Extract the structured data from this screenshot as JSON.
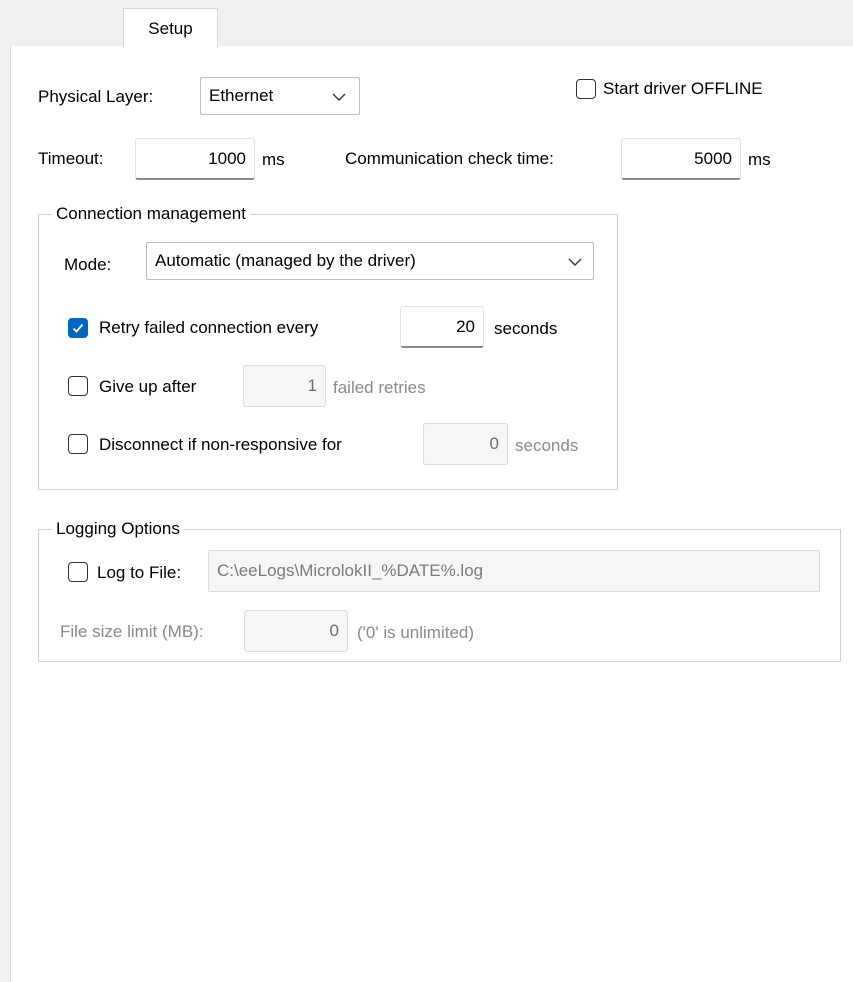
{
  "tab": {
    "label": "Setup"
  },
  "physical_layer": {
    "label": "Physical Layer:",
    "value": "Ethernet"
  },
  "start_offline": {
    "label": "Start driver OFFLINE",
    "checked": false
  },
  "timeout": {
    "label": "Timeout:",
    "value": "1000",
    "unit": "ms"
  },
  "comm_check": {
    "label": "Communication check time:",
    "value": "5000",
    "unit": "ms"
  },
  "connection": {
    "title": "Connection management",
    "mode_label": "Mode:",
    "mode_value": "Automatic (managed by the driver)",
    "retry": {
      "label": "Retry failed connection every",
      "value": "20",
      "unit": "seconds",
      "checked": true
    },
    "give_up": {
      "label": "Give up after",
      "value": "1",
      "unit": "failed retries",
      "checked": false
    },
    "disconnect": {
      "label": "Disconnect if non-responsive for",
      "value": "0",
      "unit": "seconds",
      "checked": false
    }
  },
  "logging": {
    "title": "Logging Options",
    "log_to_file": {
      "label": "Log to File:",
      "path": "C:\\eeLogs\\MicrolokII_%DATE%.log",
      "checked": false
    },
    "size_limit": {
      "label": "File size limit (MB):",
      "value": "0",
      "note": "('0' is unlimited)"
    }
  },
  "colors": {
    "accent": "#0067c0",
    "panel": "#ffffff",
    "background": "#f0f0f0"
  },
  "icons": {
    "dropdown": "chevron-down-icon",
    "check": "checkmark-icon"
  }
}
